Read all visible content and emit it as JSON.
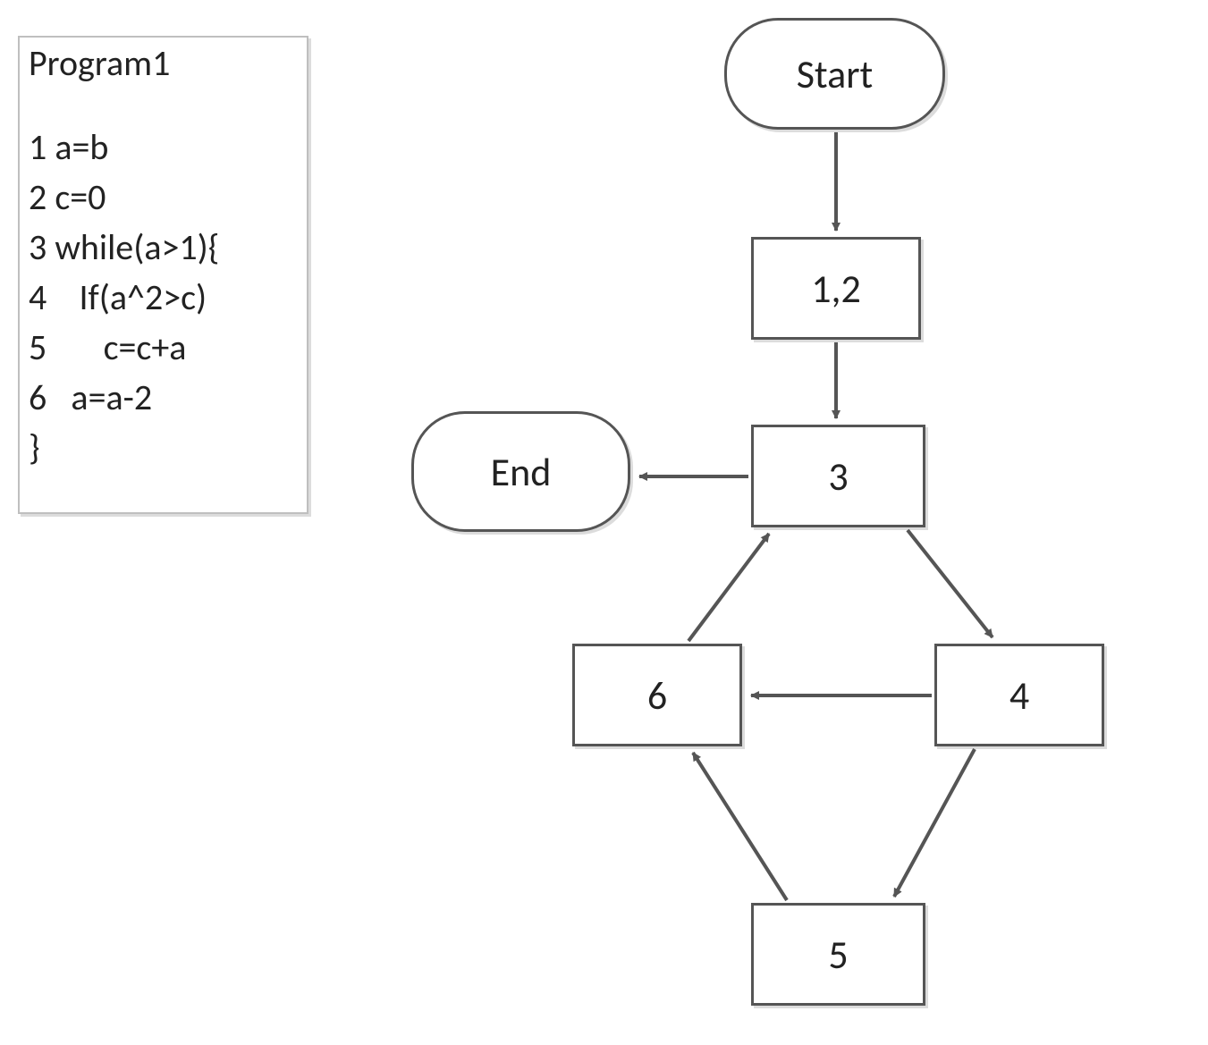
{
  "code": {
    "title": "Program1",
    "lines": [
      "1 a=b",
      "2 c=0",
      "3 while(a>1){",
      "4    If(a^2>c)",
      "5       c=c+a",
      "6   a=a-2",
      "}"
    ]
  },
  "flowchart": {
    "start": "Start",
    "end": "End",
    "node12": "1,2",
    "node3": "3",
    "node4": "4",
    "node5": "5",
    "node6": "6"
  }
}
